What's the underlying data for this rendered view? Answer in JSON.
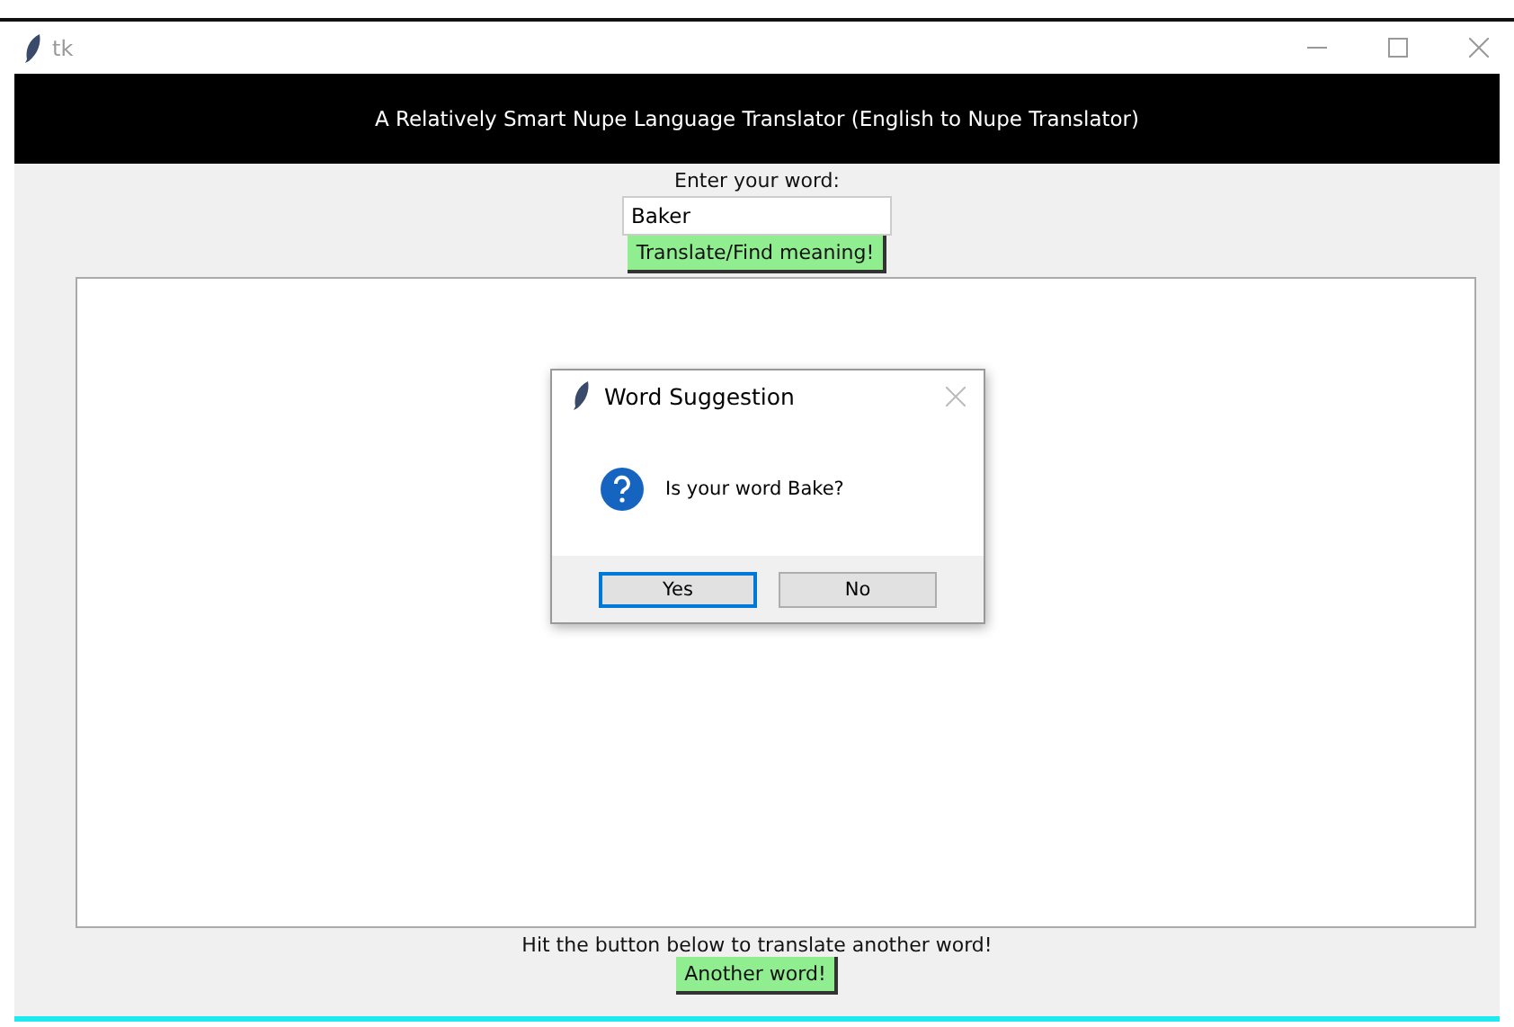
{
  "window": {
    "title": "tk"
  },
  "header": "A Relatively Smart Nupe Language Translator (English to Nupe Translator)",
  "prompt": "Enter your word:",
  "word_field": {
    "value": "Baker"
  },
  "translate_button": "Translate/Find meaning!",
  "footer_text": "Hit the button below to translate another word!",
  "another_button": "Another word!",
  "dialog": {
    "title": "Word Suggestion",
    "message": "Is your word Bake?",
    "buttons": [
      {
        "label": "Yes",
        "selected": true
      },
      {
        "label": "No",
        "selected": false
      }
    ]
  }
}
